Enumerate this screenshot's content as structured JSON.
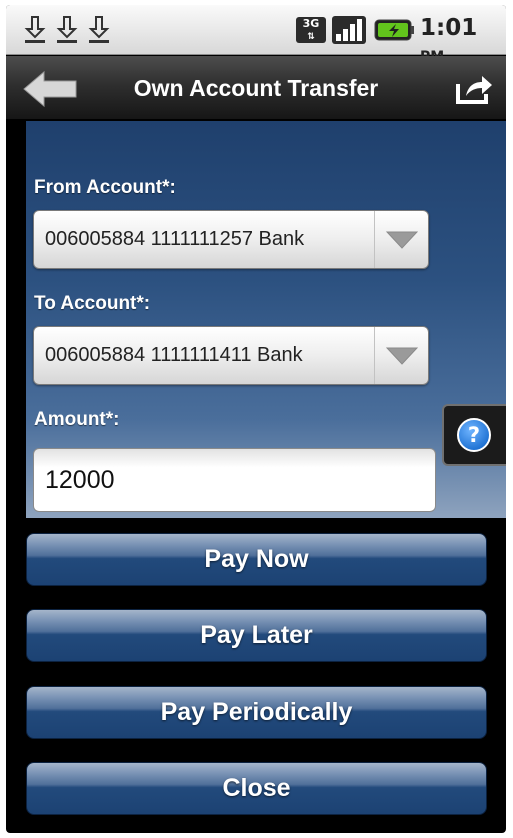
{
  "status_bar": {
    "time": "1:01",
    "ampm": "PM",
    "network": "3G",
    "icons": [
      "download-icon",
      "download-icon",
      "download-icon",
      "signal-icon",
      "battery-icon"
    ]
  },
  "title_bar": {
    "title": "Own Account Transfer",
    "icons": [
      "back-arrow-icon",
      "share-icon"
    ]
  },
  "form": {
    "from_label": "From Account*:",
    "from_value": "006005884 1111111257 Bank",
    "to_label": "To Account*:",
    "to_value": "006005884 1111111411 Bank",
    "amount_label": "Amount*:",
    "amount_value": "12000",
    "help_icon": "help-icon"
  },
  "actions": {
    "pay_now": "Pay Now",
    "pay_later": "Pay Later",
    "pay_periodically": "Pay Periodically",
    "close": "Close"
  },
  "colors": {
    "panel_top": "#1f406d",
    "panel_bottom": "#8ea3be",
    "button_blue": "#224a7c",
    "help_blue": "#1b6fd1"
  }
}
